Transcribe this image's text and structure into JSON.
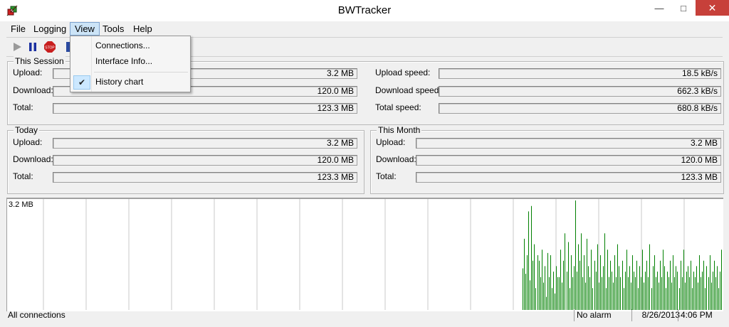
{
  "window": {
    "title": "BWTracker",
    "app_icon": "green-red-arrows-icon"
  },
  "menu": {
    "file": "File",
    "logging": "Logging",
    "view": "View",
    "tools": "Tools",
    "help": "Help"
  },
  "toolbar": {
    "icons": [
      "play-icon",
      "pause-icon",
      "stop-icon",
      "toolbar-icon"
    ]
  },
  "view_menu": {
    "connections": "Connections...",
    "interface_info": "Interface Info...",
    "history_chart": "History chart",
    "history_chart_checked": true
  },
  "this_session": {
    "title": "This Session",
    "upload_label": "Upload:",
    "upload": "3.2 MB",
    "download_label": "Download:",
    "download": "120.0 MB",
    "total_label": "Total:",
    "total": "123.3 MB",
    "upload_speed_label": "Upload speed:",
    "upload_speed": "18.5 kB/s",
    "download_speed_label": "Download speed:",
    "download_speed": "662.3 kB/s",
    "total_speed_label": "Total speed:",
    "total_speed": "680.8 kB/s"
  },
  "today": {
    "title": "Today",
    "upload_label": "Upload:",
    "upload": "3.2 MB",
    "download_label": "Download:",
    "download": "120.0 MB",
    "total_label": "Total:",
    "total": "123.3 MB"
  },
  "this_month": {
    "title": "This Month",
    "upload_label": "Upload:",
    "upload": "3.2 MB",
    "download_label": "Download:",
    "download": "120.0 MB",
    "total_label": "Total:",
    "total": "123.3 MB"
  },
  "chart_data": {
    "type": "bar",
    "ylabel": "3.2 MB",
    "series_color": "#008000",
    "values": [
      0.38,
      0.65,
      0.33,
      0.5,
      0.9,
      0.27,
      0.95,
      0.45,
      0.6,
      0.2,
      0.5,
      0.45,
      0.3,
      0.55,
      0.25,
      0.4,
      0.12,
      0.52,
      0.3,
      0.5,
      0.2,
      0.35,
      0.15,
      0.4,
      0.3,
      0.3,
      0.55,
      0.25,
      0.45,
      0.7,
      0.35,
      0.62,
      0.2,
      0.5,
      0.3,
      0.4,
      1.0,
      0.35,
      0.6,
      0.45,
      0.7,
      0.3,
      0.5,
      0.25,
      0.65,
      0.4,
      0.3,
      0.55,
      0.2,
      0.45,
      0.35,
      0.6,
      0.25,
      0.5,
      0.3,
      0.4,
      0.7,
      0.2,
      0.55,
      0.3,
      0.45,
      0.35,
      0.25,
      0.5,
      0.3,
      0.6,
      0.4,
      0.3,
      0.45,
      0.2,
      0.35,
      0.55,
      0.3,
      0.4,
      0.25,
      0.5,
      0.35,
      0.3,
      0.45,
      0.2,
      0.4,
      0.3,
      0.55,
      0.25,
      0.35,
      0.45,
      0.3,
      0.6,
      0.2,
      0.4,
      0.5,
      0.3,
      0.35,
      0.25,
      0.45,
      0.3,
      0.55,
      0.4,
      0.2,
      0.35,
      0.3,
      0.45,
      0.25,
      0.5,
      0.3,
      0.4,
      0.35,
      0.2,
      0.45,
      0.3,
      0.55,
      0.25,
      0.35,
      0.4,
      0.3,
      0.45,
      0.2,
      0.35,
      0.3,
      0.4,
      0.25,
      0.5,
      0.3,
      0.35,
      0.45,
      0.2,
      0.4,
      0.3,
      0.5,
      0.25,
      0.35,
      0.45,
      0.3,
      0.4,
      0.2,
      0.35,
      0.55
    ]
  },
  "status": {
    "connections": "All connections",
    "alarm": "No alarm",
    "date": "8/26/2013",
    "time": "4:06 PM"
  }
}
